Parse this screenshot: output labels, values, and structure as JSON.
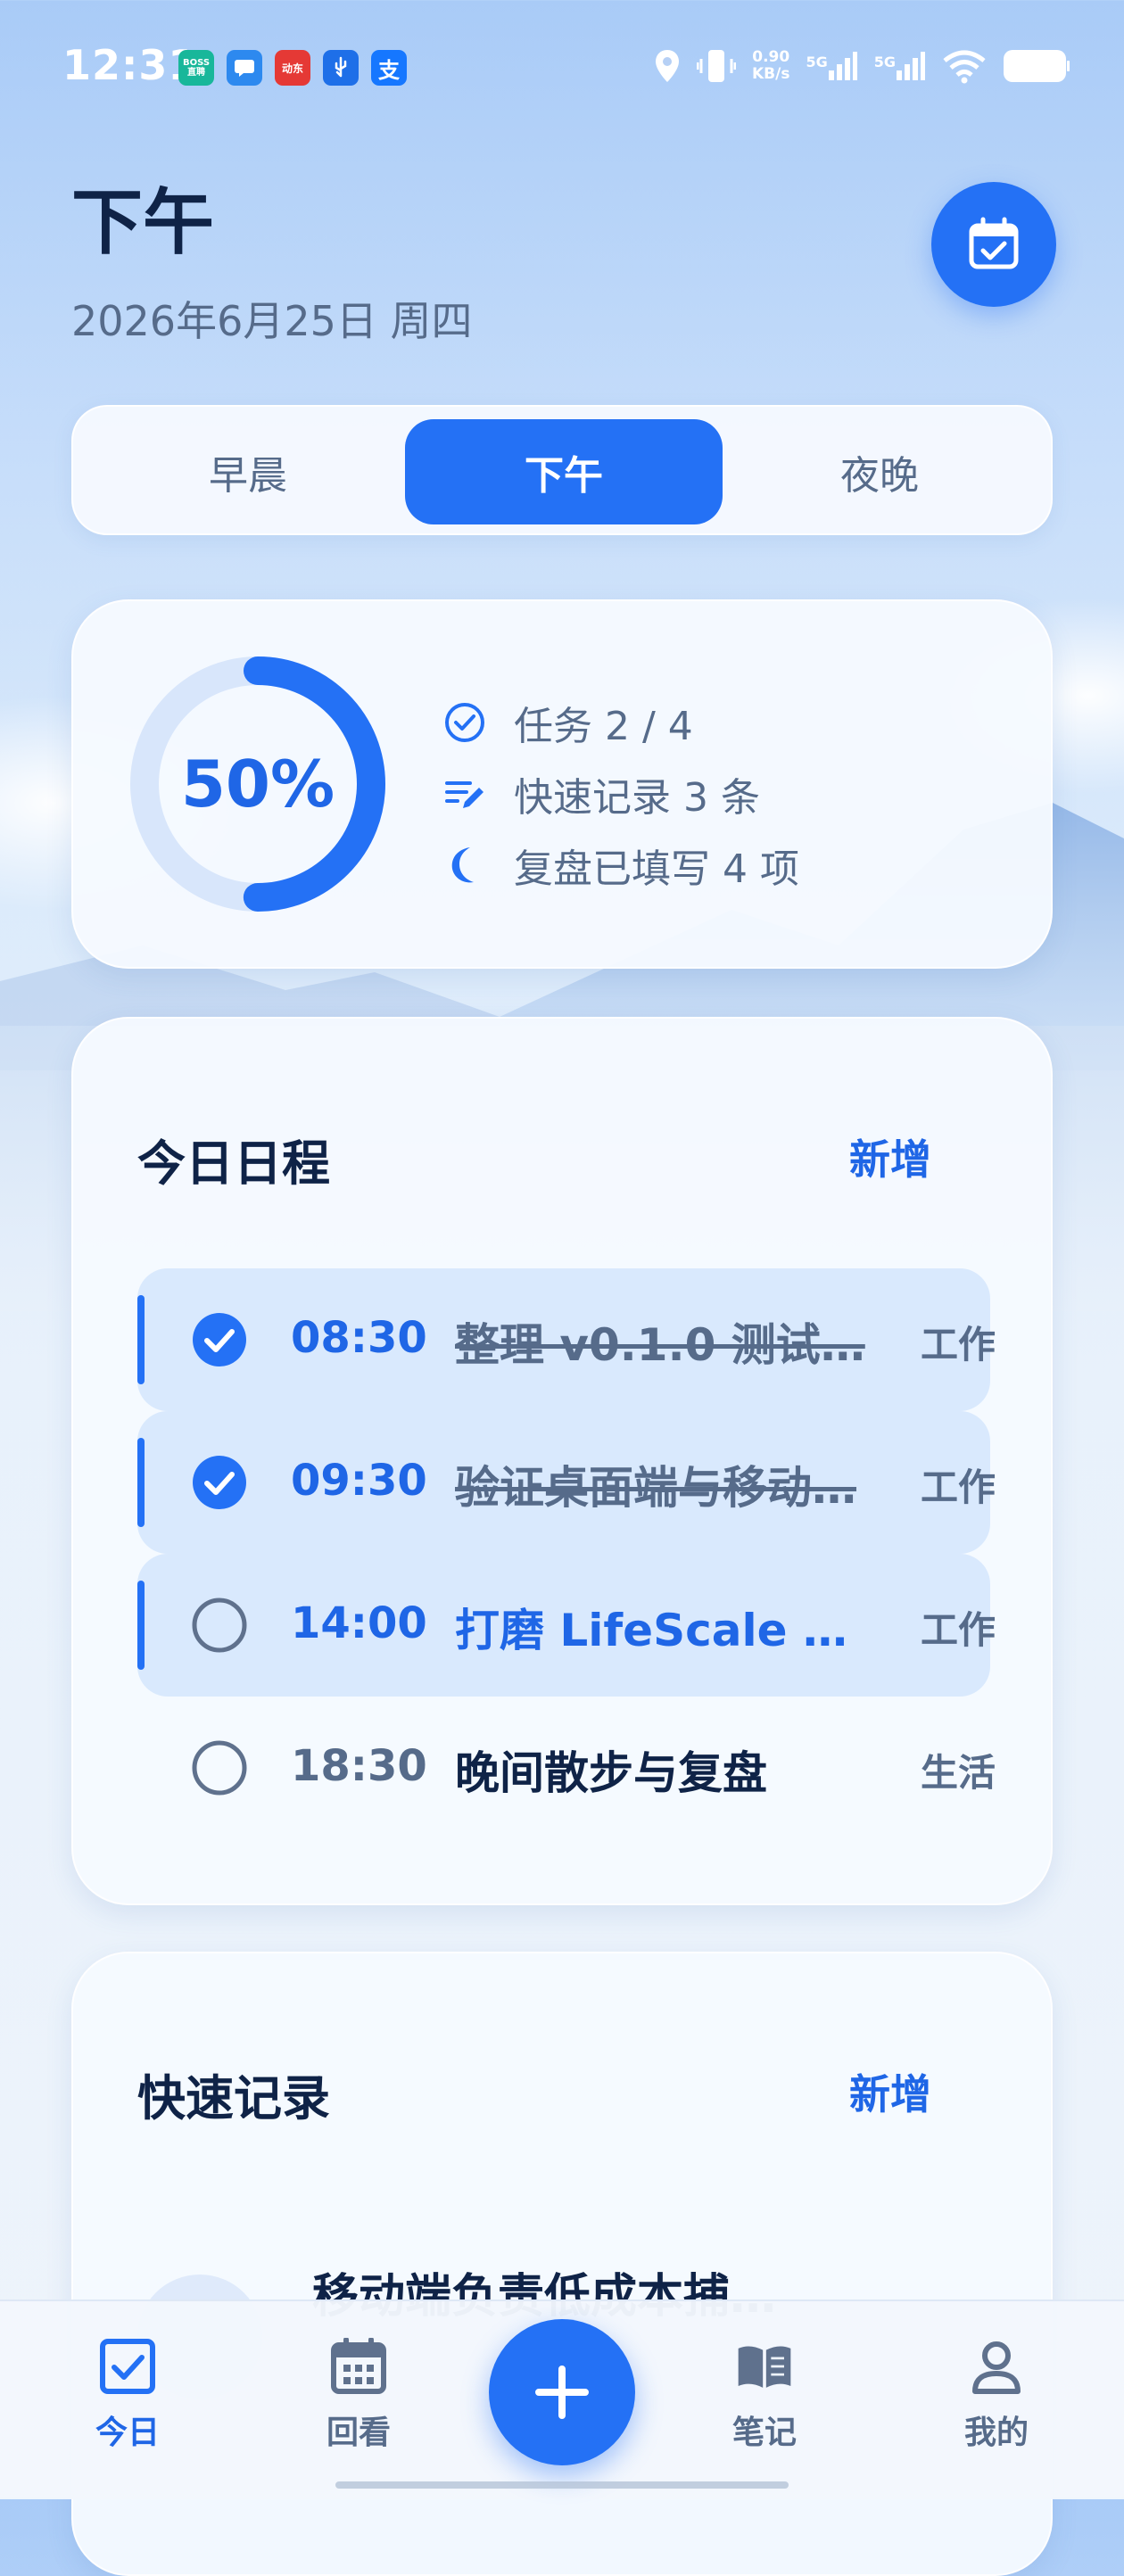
{
  "status_bar": {
    "time": "12:31",
    "net_speed_value": "0.90",
    "net_speed_unit": "KB/s",
    "signal_1": "5G",
    "signal_2": "5G",
    "app_icons": [
      "boss-zhipin-icon",
      "message-icon",
      "dongfang-icon",
      "usb-icon",
      "alipay-icon"
    ],
    "app_icon_labels": [
      "BOSS直聘",
      "",
      "动东",
      "",
      "支"
    ]
  },
  "header": {
    "title": "下午",
    "date": "2026年6月25日 周四"
  },
  "segment": {
    "options": [
      "早晨",
      "下午",
      "夜晚"
    ],
    "selected": "下午"
  },
  "summary": {
    "progress_percent": 50,
    "progress_label": "50%",
    "stats": [
      {
        "icon": "check-circle-icon",
        "text": "任务 2 / 4"
      },
      {
        "icon": "edit-lines-icon",
        "text": "快速记录 3 条"
      },
      {
        "icon": "moon-icon",
        "text": "复盘已填写 4 项"
      }
    ]
  },
  "schedule": {
    "title": "今日日程",
    "action": "新增",
    "items": [
      {
        "time": "08:30",
        "title": "整理 v0.1.0 测试…",
        "tag": "工作",
        "done": true,
        "highlight": true
      },
      {
        "time": "09:30",
        "title": "验证桌面端与移动…",
        "tag": "工作",
        "done": true,
        "highlight": true
      },
      {
        "time": "14:00",
        "title": "打磨 LifeScale 产…",
        "tag": "工作",
        "done": false,
        "highlight": true
      },
      {
        "time": "18:30",
        "title": "晚间散步与复盘",
        "tag": "生活",
        "done": false,
        "highlight": false
      }
    ]
  },
  "quick_notes": {
    "title": "快速记录",
    "action": "新增",
    "items": [
      {
        "text": "移动端负责低成本捕…"
      }
    ]
  },
  "tab_bar": {
    "items": [
      {
        "label": "今日",
        "icon": "checkbox-icon",
        "active": true
      },
      {
        "label": "回看",
        "icon": "calendar-grid-icon",
        "active": false
      },
      {
        "label": "笔记",
        "icon": "book-icon",
        "active": false
      },
      {
        "label": "我的",
        "icon": "user-icon",
        "active": false
      }
    ],
    "fab_icon": "plus-icon"
  },
  "colors": {
    "accent": "#2471f5",
    "title": "#0f2347",
    "muted": "#566b8a",
    "row_tint": "#d6e7fd"
  }
}
